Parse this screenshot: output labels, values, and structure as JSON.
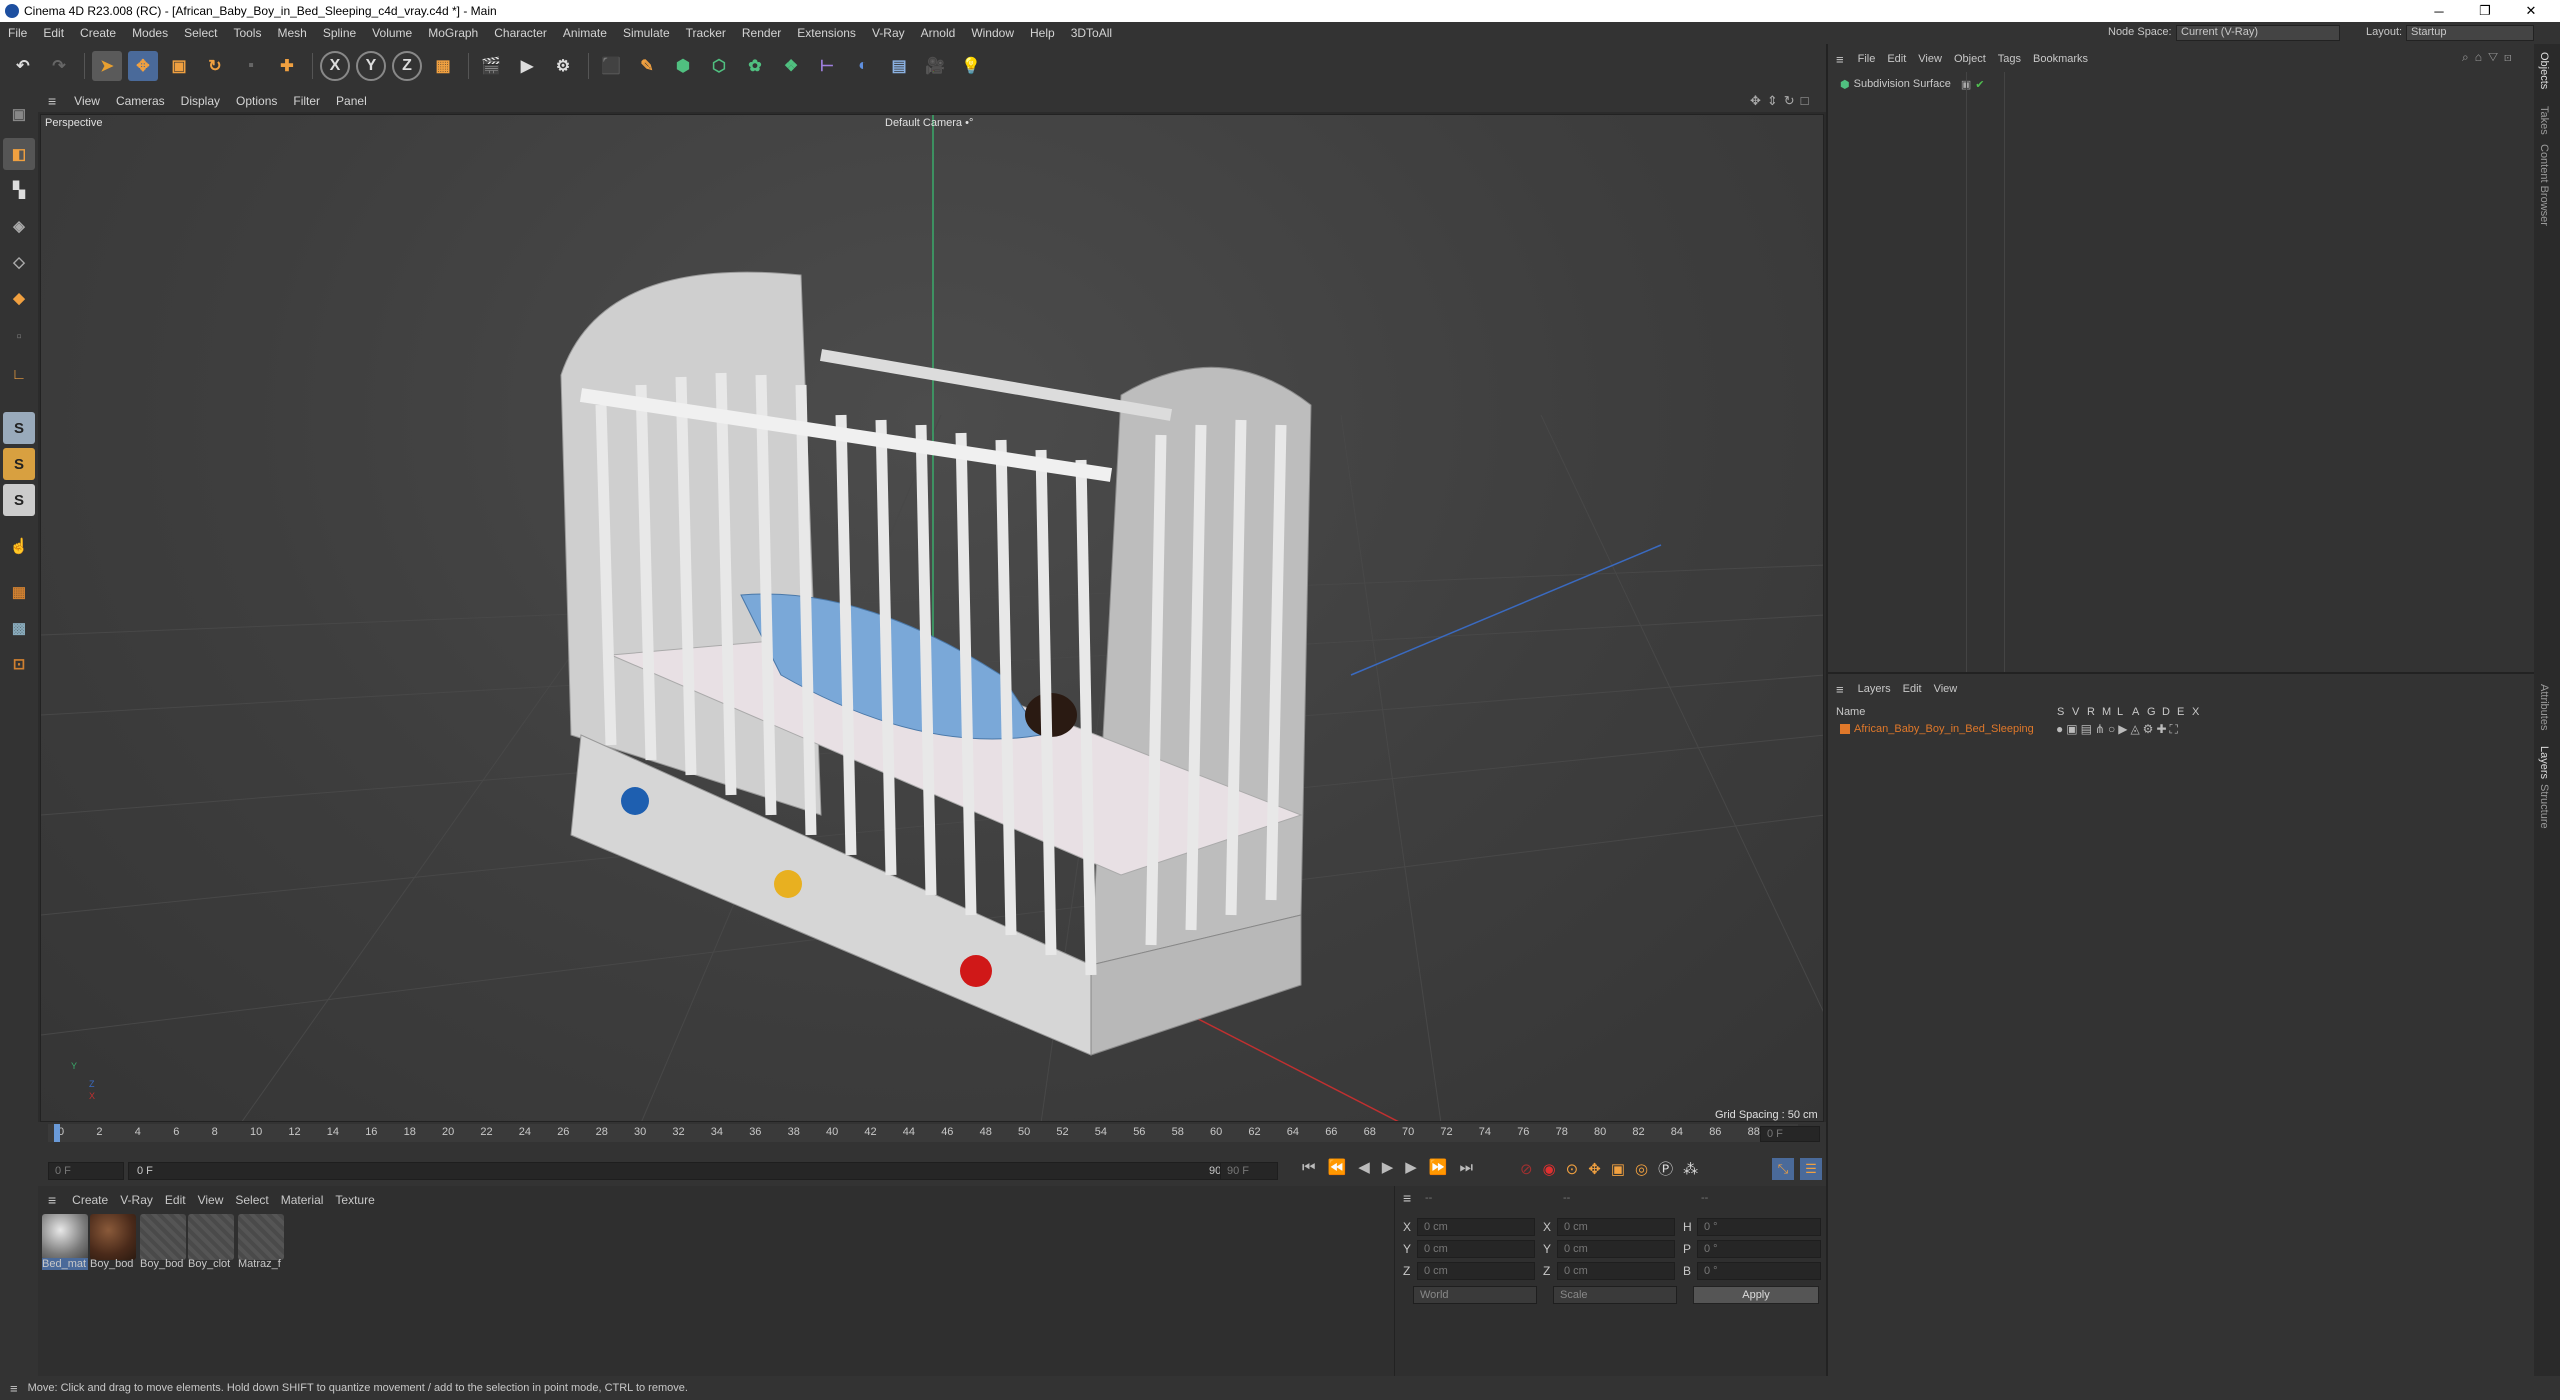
{
  "window": {
    "title": "Cinema 4D R23.008 (RC) - [African_Baby_Boy_in_Bed_Sleeping_c4d_vray.c4d *] - Main",
    "minimize": "─",
    "maximize": "❐",
    "close": "✕"
  },
  "menu": {
    "items": [
      "File",
      "Edit",
      "Create",
      "Modes",
      "Select",
      "Tools",
      "Mesh",
      "Spline",
      "Volume",
      "MoGraph",
      "Character",
      "Animate",
      "Simulate",
      "Tracker",
      "Render",
      "Extensions",
      "V-Ray",
      "Arnold",
      "Window",
      "Help",
      "3DToAll"
    ],
    "node_space_label": "Node Space:",
    "node_space_value": "Current (V-Ray)",
    "layout_label": "Layout:",
    "layout_value": "Startup"
  },
  "toolbar": {
    "axis_x": "X",
    "axis_y": "Y",
    "axis_z": "Z"
  },
  "viewport": {
    "menu": [
      "View",
      "Cameras",
      "Display",
      "Options",
      "Filter",
      "Panel"
    ],
    "view_name": "Perspective",
    "camera": "Default Camera •°",
    "grid_spacing": "Grid Spacing : 50 cm",
    "axis_y": "Y",
    "axis_z": "Z",
    "axis_x": "X"
  },
  "timeline": {
    "ticks": [
      "0",
      "2",
      "4",
      "6",
      "8",
      "10",
      "12",
      "14",
      "16",
      "18",
      "20",
      "22",
      "24",
      "26",
      "28",
      "30",
      "32",
      "34",
      "36",
      "38",
      "40",
      "42",
      "44",
      "46",
      "48",
      "50",
      "52",
      "54",
      "56",
      "58",
      "60",
      "62",
      "64",
      "66",
      "68",
      "70",
      "72",
      "74",
      "76",
      "78",
      "80",
      "82",
      "84",
      "86",
      "88",
      "90"
    ],
    "current_frame": "0 F",
    "start_frame": "0 F",
    "range_start": "0 F",
    "range_end": "90 F",
    "end_frame": "90 F"
  },
  "materials": {
    "menu": [
      "Create",
      "V-Ray",
      "Edit",
      "View",
      "Select",
      "Material",
      "Texture"
    ],
    "items": [
      {
        "name": "Bed_mat",
        "color": "#8a8a8a"
      },
      {
        "name": "Boy_bod",
        "color": "#4a2a1a"
      },
      {
        "name": "Boy_bod",
        "color": "#555555"
      },
      {
        "name": "Boy_clot",
        "color": "#555555"
      },
      {
        "name": "Matraz_f",
        "color": "#555555"
      }
    ]
  },
  "coords": {
    "header": [
      "--",
      "--",
      "--"
    ],
    "rows": [
      {
        "a": "X",
        "av": "0 cm",
        "b": "X",
        "bv": "0 cm",
        "c": "H",
        "cv": "0 °"
      },
      {
        "a": "Y",
        "av": "0 cm",
        "b": "Y",
        "bv": "0 cm",
        "c": "P",
        "cv": "0 °"
      },
      {
        "a": "Z",
        "av": "0 cm",
        "b": "Z",
        "bv": "0 cm",
        "c": "B",
        "cv": "0 °"
      }
    ],
    "mode": "World",
    "transform": "Scale",
    "apply": "Apply"
  },
  "status": "Move: Click and drag to move elements. Hold down SHIFT to quantize movement / add to the selection in point mode, CTRL to remove.",
  "objects": {
    "menu": [
      "File",
      "Edit",
      "View",
      "Object",
      "Tags",
      "Bookmarks"
    ],
    "item": "Subdivision Surface"
  },
  "layers": {
    "menu": [
      "Layers",
      "Edit",
      "View"
    ],
    "col_name": "Name",
    "flags": [
      "S",
      "V",
      "R",
      "M",
      "L",
      "A",
      "G",
      "D",
      "E",
      "X"
    ],
    "item": "African_Baby_Boy_in_Bed_Sleeping",
    "item_color": "#e0782a"
  },
  "side_tabs": [
    "Objects",
    "Takes",
    "Content Browser",
    "Attributes",
    "Layers",
    "Structure"
  ]
}
